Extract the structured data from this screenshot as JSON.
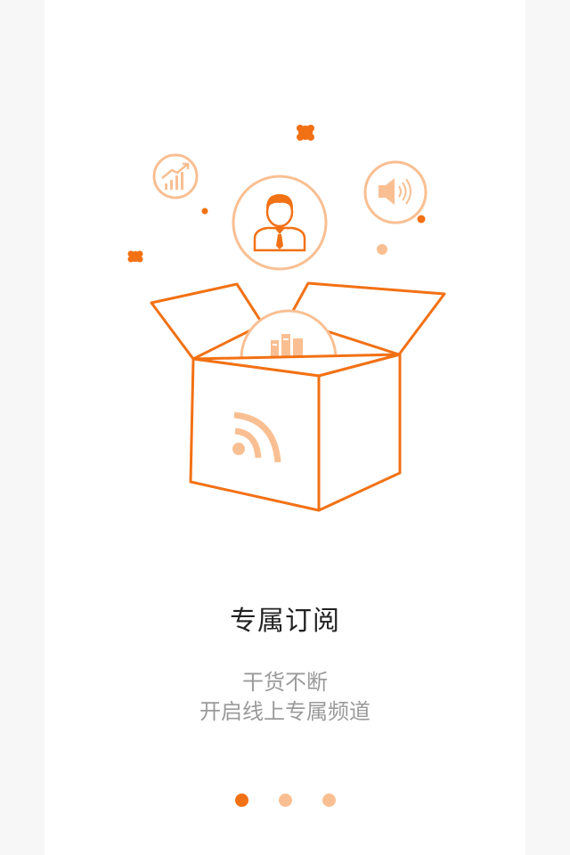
{
  "colors": {
    "accent": "#f27114",
    "accent_light": "#f9bf92",
    "title_text": "#222222",
    "subtitle_text": "#9a9a9a"
  },
  "illustration": {
    "icons": [
      "growth-chart-icon",
      "person-icon",
      "speaker-icon",
      "books-icon",
      "rss-icon",
      "open-box-icon"
    ]
  },
  "onboarding": {
    "title": "专属订阅",
    "subtitle_line1": "干货不断",
    "subtitle_line2": "开启线上专属频道"
  },
  "pager": {
    "total": 3,
    "active_index": 0
  }
}
